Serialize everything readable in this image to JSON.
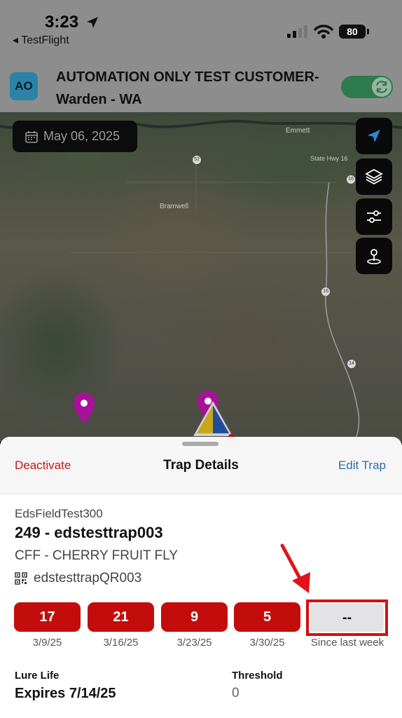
{
  "status_bar": {
    "time": "3:23",
    "back_app": "◂ TestFlight",
    "battery": "80"
  },
  "header": {
    "avatar": "AO",
    "customer": "AUTOMATION ONLY TEST CUSTOMER- Warden - WA",
    "sync_on": true
  },
  "map": {
    "date": "May 06, 2025",
    "towns": [
      "Emmett",
      "Bramwell",
      "State Hwy 16"
    ],
    "route_shields": [
      "52",
      "16",
      "16",
      "14"
    ],
    "buttons": [
      "location-arrow-icon",
      "layers-icon",
      "filter-sliders-icon",
      "map-pin-drop-icon"
    ]
  },
  "sheet": {
    "deactivate": "Deactivate",
    "title": "Trap Details",
    "edit": "Edit Trap",
    "field": "EdsFieldTest300",
    "trap_name": "249 - edstesttrap003",
    "species": "CFF - CHERRY FRUIT FLY",
    "qr": "edstesttrapQR003",
    "counts": [
      {
        "value": "17",
        "date": "3/9/25"
      },
      {
        "value": "21",
        "date": "3/16/25"
      },
      {
        "value": "9",
        "date": "3/23/25"
      },
      {
        "value": "5",
        "date": "3/30/25"
      }
    ],
    "since": {
      "value": "--",
      "label": "Since last week"
    },
    "lure_label": "Lure Life",
    "lure_value": "Expires 7/14/25",
    "threshold_label": "Threshold",
    "threshold_value": "0"
  },
  "colors": {
    "accent_red": "#c30d0d",
    "link_blue": "#2d6eb0",
    "toggle_green": "#2e7b4e",
    "pin_magenta": "#a8119a"
  }
}
